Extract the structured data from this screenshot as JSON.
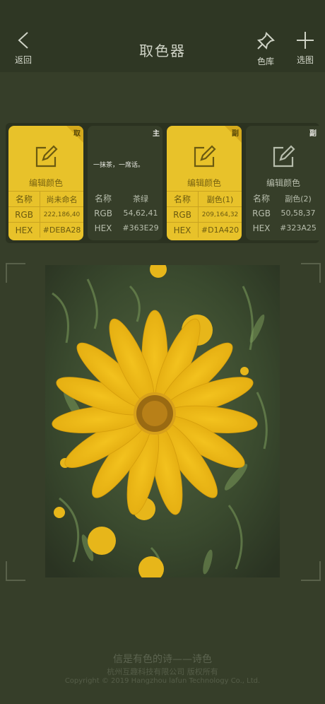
{
  "header": {
    "back_label": "返回",
    "title": "取色器",
    "library_label": "色库",
    "pick_label": "选图"
  },
  "cards": [
    {
      "tag": "取",
      "edit_label": "编辑颜色",
      "rows": [
        [
          "名称",
          "尚未命名"
        ],
        [
          "RGB",
          "222,186,40"
        ],
        [
          "HEX",
          "#DEBA28"
        ]
      ]
    },
    {
      "tag": "主",
      "poem": "一抹茶，一席话。",
      "rows": [
        [
          "名称",
          "茶绿"
        ],
        [
          "RGB",
          "54,62,41"
        ],
        [
          "HEX",
          "#363E29"
        ]
      ]
    },
    {
      "tag": "副",
      "edit_label": "编辑颜色",
      "rows": [
        [
          "名称",
          "副色(1)"
        ],
        [
          "RGB",
          "209,164,32"
        ],
        [
          "HEX",
          "#D1A420"
        ]
      ]
    },
    {
      "tag": "副",
      "edit_label": "编辑颜色",
      "rows": [
        [
          "名称",
          "副色(2)"
        ],
        [
          "RGB",
          "50,58,37"
        ],
        [
          "HEX",
          "#323A25"
        ]
      ]
    }
  ],
  "footer": {
    "slogan": "信是有色的诗——诗色",
    "company": "杭州互趣科技有限公司 版权所有",
    "copyright": "Copyright © 2019 Hangzhou lafun Technology Co., Ltd."
  },
  "colors": {
    "background": "#363E29",
    "accent_yellow": "#DEBA28",
    "accent_yellow2": "#D1A420",
    "dark2": "#323A25"
  }
}
